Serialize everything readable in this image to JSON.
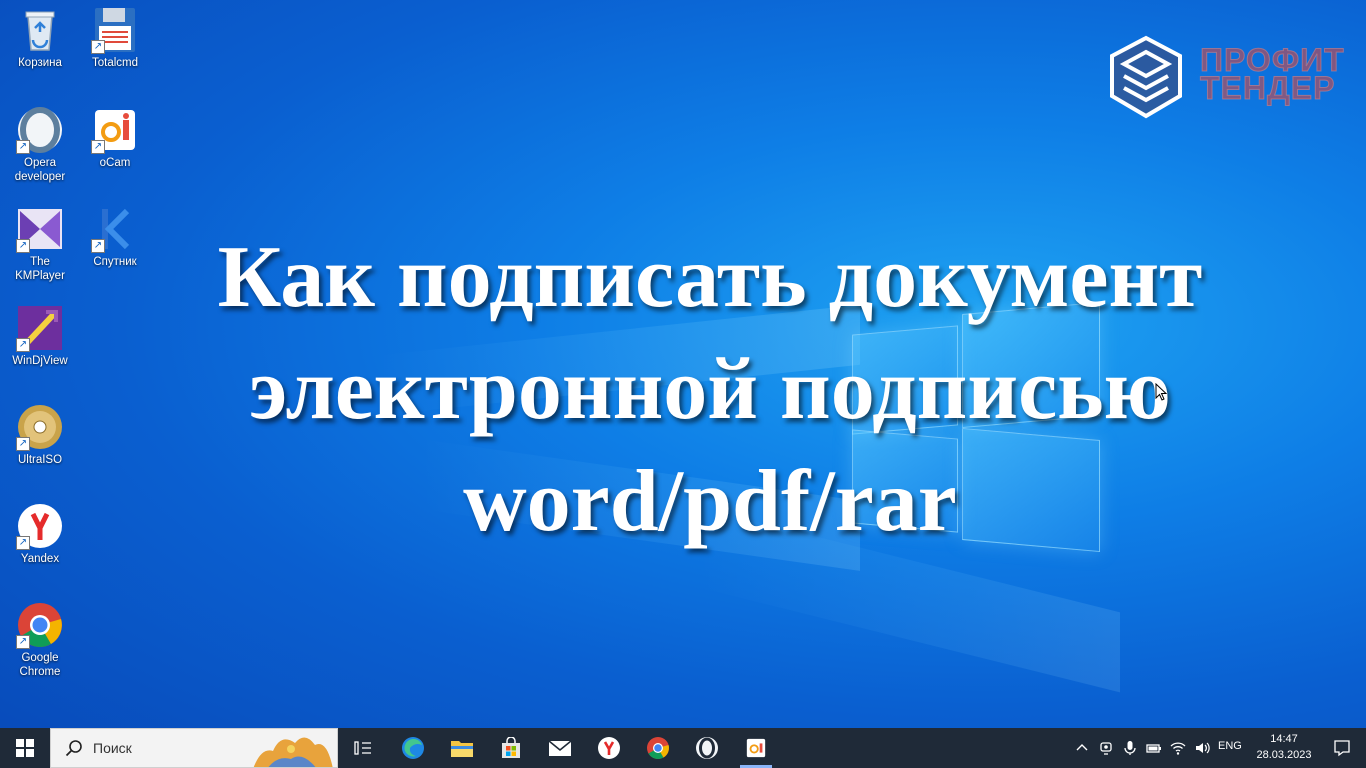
{
  "headline": {
    "line1": "Как подписать документ",
    "line2": "электронной подписью",
    "line3": "word/pdf/rar"
  },
  "brand": {
    "line1": "ПРОФИТ",
    "line2": "ТЕНДЕР"
  },
  "desktop_icons": [
    {
      "label": "Корзина"
    },
    {
      "label": "Totalcmd"
    },
    {
      "label": "Opera\ndeveloper"
    },
    {
      "label": "oCam"
    },
    {
      "label": "The\nKMPlayer"
    },
    {
      "label": "Спутник"
    },
    {
      "label": "WinDjView"
    },
    {
      "label": "UltraISO"
    },
    {
      "label": "Yandex"
    },
    {
      "label": "Google\nChrome"
    }
  ],
  "taskbar": {
    "search_placeholder": "Поиск",
    "pinned": [
      "task-view",
      "edge",
      "file-explorer",
      "store",
      "mail",
      "yandex",
      "chrome",
      "opera",
      "ocam"
    ],
    "tray": {
      "language": "ENG",
      "time": "14:47",
      "date": "28.03.2023"
    }
  },
  "colors": {
    "desktop_blue": "#0e7ee6",
    "taskbar": "#1f2a38",
    "brand_red": "#dc463c"
  }
}
